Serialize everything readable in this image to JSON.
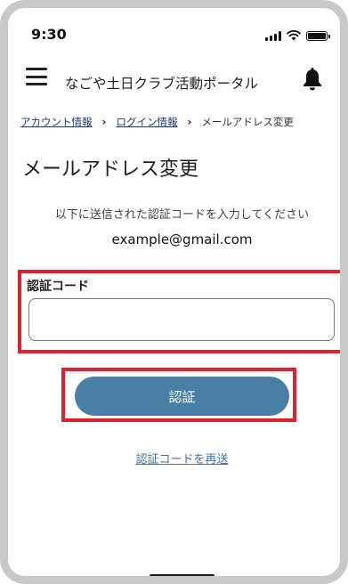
{
  "status_bar": {
    "time": "9:30"
  },
  "header": {
    "app_title": "なごや土日クラブ活動ポータル"
  },
  "breadcrumb": {
    "items": [
      "アカウント情報",
      "ログイン情報"
    ],
    "separator": "›",
    "current": "メールアドレス変更"
  },
  "page": {
    "title": "メールアドレス変更",
    "instruction": "以下に送信された認証コードを入力してください",
    "email": "example@gmail.com"
  },
  "form": {
    "code_label": "認証コード",
    "code_value": "",
    "verify_button": "認証",
    "resend_link": "認証コードを再送"
  },
  "colors": {
    "primary_button": "#4a7fa5",
    "highlight_border": "#e0212b",
    "link": "#3f73a8",
    "breadcrumb_link": "#1f3a64"
  }
}
